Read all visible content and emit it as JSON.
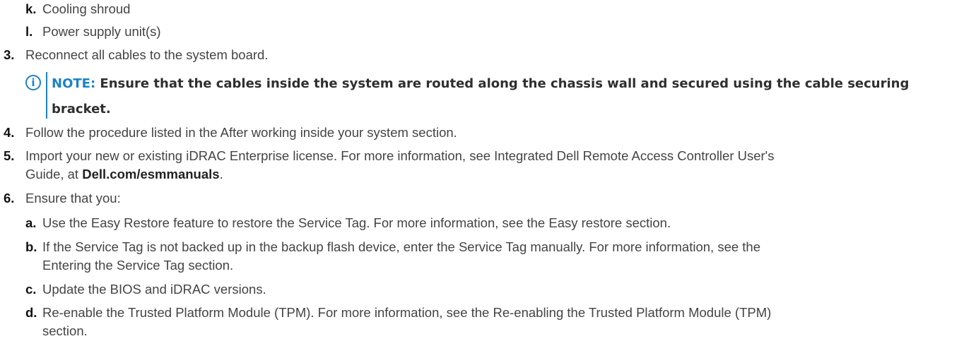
{
  "items": [
    {
      "marker": "k.",
      "text": "Cooling shroud"
    },
    {
      "marker": "l.",
      "text": "Power supply unit(s)"
    },
    {
      "marker": "3.",
      "text": "Reconnect all cables to the system board."
    },
    {
      "marker": "4.",
      "text": "Follow the procedure listed in the After working inside your system section."
    },
    {
      "marker": "5.",
      "text_line1": "Import your new or existing iDRAC Enterprise license. For more information, see Integrated Dell Remote Access Controller User's",
      "text_line2_prefix": "Guide, at ",
      "link": "Dell.com/esmmanuals",
      "text_line2_suffix": "."
    },
    {
      "marker": "6.",
      "text": "Ensure that you:"
    }
  ],
  "note": {
    "label": "NOTE:",
    "text": " Ensure that the cables inside the system are routed along the chassis wall and secured using the cable securing bracket."
  },
  "subitems": [
    {
      "marker": "a.",
      "text": "Use the Easy Restore feature to restore the Service Tag. For more information, see the Easy restore section."
    },
    {
      "marker": "b.",
      "text_line1": "If the Service Tag is not backed up in the backup flash device, enter the Service Tag manually. For more information, see the",
      "text_line2": "Entering the Service Tag section."
    },
    {
      "marker": "c.",
      "text": "Update the BIOS and iDRAC versions."
    },
    {
      "marker": "d.",
      "text_line1": "Re-enable the Trusted Platform Module (TPM). For more information, see the Re-enabling the Trusted Platform Module (TPM)",
      "text_line2": "section."
    }
  ],
  "colors": {
    "note_accent": "#1a83c6",
    "body_text": "#444444",
    "marker_text": "#111111"
  },
  "icons": {
    "note": "info-circle-icon"
  }
}
